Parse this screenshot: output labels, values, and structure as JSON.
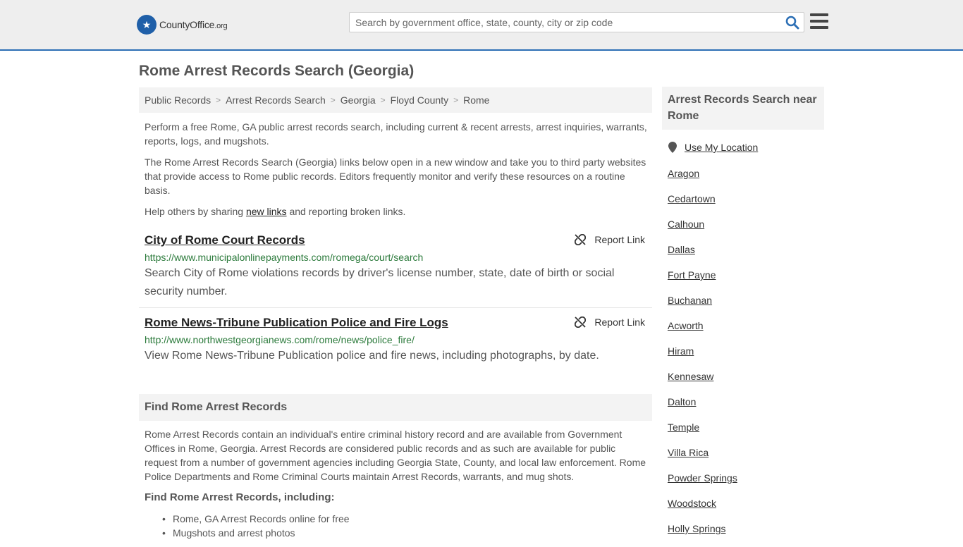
{
  "header": {
    "logo_brand": "CountyOffice",
    "logo_tld": ".org",
    "search_placeholder": "Search by government office, state, county, city or zip code"
  },
  "page": {
    "title": "Rome Arrest Records Search (Georgia)"
  },
  "breadcrumb": [
    "Public Records",
    "Arrest Records Search",
    "Georgia",
    "Floyd County",
    "Rome"
  ],
  "intro": {
    "p1": "Perform a free Rome, GA public arrest records search, including current & recent arrests, arrest inquiries, warrants, reports, logs, and mugshots.",
    "p2": "The Rome Arrest Records Search (Georgia) links below open in a new window and take you to third party websites that provide access to Rome public records. Editors frequently monitor and verify these resources on a routine basis.",
    "p3_before": "Help others by sharing ",
    "p3_link": "new links",
    "p3_after": " and reporting broken links."
  },
  "results": [
    {
      "title": "City of Rome Court Records",
      "report_label": "Report Link",
      "url": "https://www.municipalonlinepayments.com/romega/court/search",
      "description": "Search City of Rome violations records by driver's license number, state, date of birth or social security number."
    },
    {
      "title": "Rome News-Tribune Publication Police and Fire Logs",
      "report_label": "Report Link",
      "url": "http://www.northwestgeorgianews.com/rome/news/police_fire/",
      "description": "View Rome News-Tribune Publication police and fire news, including photographs, by date."
    }
  ],
  "find_section": {
    "heading": "Find Rome Arrest Records",
    "body": "Rome Arrest Records contain an individual's entire criminal history record and are available from Government Offices in Rome, Georgia. Arrest Records are considered public records and as such are available for public request from a number of government agencies including Georgia State, County, and local law enforcement. Rome Police Departments and Rome Criminal Courts maintain Arrest Records, warrants, and mug shots.",
    "subheading": "Find Rome Arrest Records, including:",
    "bullets": [
      "Rome, GA Arrest Records online for free",
      "Mugshots and arrest photos"
    ]
  },
  "sidebar": {
    "heading": "Arrest Records Search near Rome",
    "use_location": "Use My Location",
    "cities": [
      "Aragon",
      "Cedartown",
      "Calhoun",
      "Dallas",
      "Fort Payne",
      "Buchanan",
      "Acworth",
      "Hiram",
      "Kennesaw",
      "Dalton",
      "Temple",
      "Villa Rica",
      "Powder Springs",
      "Woodstock",
      "Holly Springs"
    ]
  },
  "colors": {
    "accent": "#2c6fb5",
    "url_green": "#2b7a3b"
  }
}
